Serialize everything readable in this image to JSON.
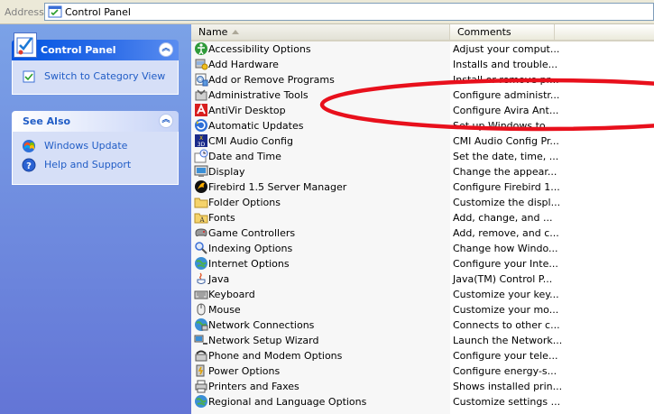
{
  "address": {
    "label": "Address",
    "value": "Control Panel"
  },
  "taskpane": {
    "control_panel": {
      "title": "Control Panel",
      "switch_label": "Switch to Category View"
    },
    "see_also": {
      "title": "See Also",
      "items": [
        {
          "label": "Windows Update",
          "icon": "windows-update-icon"
        },
        {
          "label": "Help and Support",
          "icon": "help-icon"
        }
      ]
    }
  },
  "list": {
    "columns": {
      "name": "Name",
      "comments": "Comments"
    },
    "rows": [
      {
        "name": "Accessibility Options",
        "comment": "Adjust your comput...",
        "icon": "accessibility-icon"
      },
      {
        "name": "Add Hardware",
        "comment": "Installs and trouble...",
        "icon": "add-hardware-icon"
      },
      {
        "name": "Add or Remove Programs",
        "comment": "Install or remove pr...",
        "icon": "add-remove-programs-icon"
      },
      {
        "name": "Administrative Tools",
        "comment": "Configure administr...",
        "icon": "admin-tools-icon"
      },
      {
        "name": "AntiVir Desktop",
        "comment": "Configure Avira Ant...",
        "icon": "antivir-icon"
      },
      {
        "name": "Automatic Updates",
        "comment": "Set up Windows to ...",
        "icon": "automatic-updates-icon"
      },
      {
        "name": "CMI Audio Config",
        "comment": "CMI Audio Config Pr...",
        "icon": "cmi-audio-icon"
      },
      {
        "name": "Date and Time",
        "comment": "Set the date, time, ...",
        "icon": "date-time-icon"
      },
      {
        "name": "Display",
        "comment": "Change the appear...",
        "icon": "display-icon"
      },
      {
        "name": "Firebird 1.5 Server Manager",
        "comment": "Configure Firebird 1...",
        "icon": "firebird-icon"
      },
      {
        "name": "Folder Options",
        "comment": "Customize the displ...",
        "icon": "folder-options-icon"
      },
      {
        "name": "Fonts",
        "comment": "Add, change, and ...",
        "icon": "fonts-icon"
      },
      {
        "name": "Game Controllers",
        "comment": "Add, remove, and c...",
        "icon": "game-controllers-icon"
      },
      {
        "name": "Indexing Options",
        "comment": "Change how Windo...",
        "icon": "indexing-icon"
      },
      {
        "name": "Internet Options",
        "comment": "Configure your Inte...",
        "icon": "internet-options-icon"
      },
      {
        "name": "Java",
        "comment": "Java(TM) Control P...",
        "icon": "java-icon"
      },
      {
        "name": "Keyboard",
        "comment": "Customize your key...",
        "icon": "keyboard-icon"
      },
      {
        "name": "Mouse",
        "comment": "Customize your mo...",
        "icon": "mouse-icon"
      },
      {
        "name": "Network Connections",
        "comment": "Connects to other c...",
        "icon": "network-connections-icon"
      },
      {
        "name": "Network Setup Wizard",
        "comment": "Launch the Network...",
        "icon": "network-wizard-icon"
      },
      {
        "name": "Phone and Modem Options",
        "comment": "Configure your tele...",
        "icon": "phone-modem-icon"
      },
      {
        "name": "Power Options",
        "comment": "Configure energy-s...",
        "icon": "power-options-icon"
      },
      {
        "name": "Printers and Faxes",
        "comment": "Shows installed prin...",
        "icon": "printers-icon"
      },
      {
        "name": "Regional and Language Options",
        "comment": "Customize settings ...",
        "icon": "regional-icon"
      }
    ]
  },
  "annotation": {
    "color": "#e8101c",
    "highlighted_row": "Add or Remove Programs"
  },
  "colors": {
    "taskpane_top": "#7ba2e7",
    "taskpane_bottom": "#6375d6",
    "link": "#215dc6"
  }
}
